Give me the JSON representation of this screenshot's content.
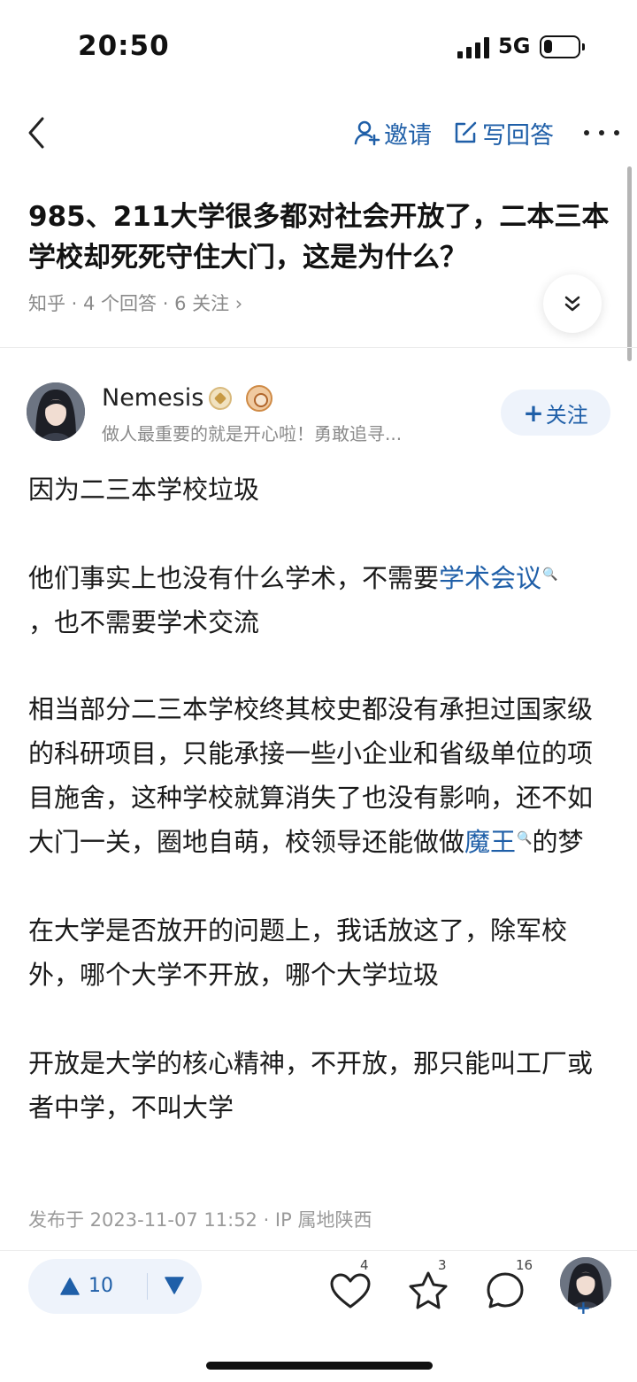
{
  "status_bar": {
    "time": "20:50",
    "network": "5G",
    "battery_level": 0.25
  },
  "nav": {
    "back_icon": "chevron-left-icon",
    "invite_label": "邀请",
    "write_answer_label": "写回答",
    "more_icon": "ellipsis-icon"
  },
  "question": {
    "title": "985、211大学很多都对社会开放了，二本三本学校却死死守住大门，这是为什么？",
    "meta": "知乎 · 4 个回答 · 6 关注 ›"
  },
  "author": {
    "name": "Nemesis",
    "bio": "做人最重要的就是开心啦！勇敢追寻...",
    "follow_label": "关注",
    "follow_plus": "+"
  },
  "answer": {
    "p1": "因为二三本学校垃圾",
    "p2_before": "他们事实上也没有什么学术，不需要",
    "p2_link": "学术会议",
    "p2_after": "，也不需要学术交流",
    "p3_before": "相当部分二三本学校终其校史都没有承担过国家级的科研项目，只能承接一些小企业和省级单位的项目施舍，这种学校就算消失了也没有影响，还不如大门一关，圈地自萌，校领导还能做做",
    "p3_link": "魔王",
    "p3_after": "的梦",
    "p4": "在大学是否放开的问题上，我话放这了，除军校外，哪个大学不开放，哪个大学垃圾",
    "p5": "开放是大学的核心精神，不开放，那只能叫工厂或者中学，不叫大学",
    "search_mark": "🔍"
  },
  "publish": "发布于 2023-11-07 11:52 · IP 属地陕西",
  "actions": {
    "upvote_count": "10",
    "like_count": "4",
    "favorite_count": "3",
    "comment_count": "16",
    "add_plus": "+"
  }
}
